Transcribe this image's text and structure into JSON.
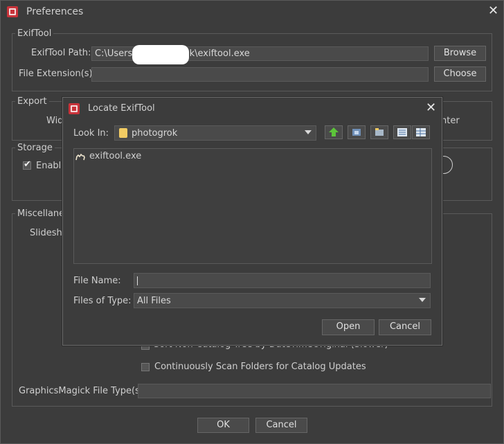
{
  "window": {
    "title": "Preferences",
    "exiftool_group": {
      "label": "ExifTool",
      "path_label": "ExifTool Path:",
      "path_prefix": "C:\\Users\\",
      "path_suffix": "k\\exiftool.exe",
      "browse": "Browse",
      "ext_label": "File Extension(s):",
      "choose": "Choose"
    },
    "export_group": {
      "label": "Export",
      "partial_left": "Wid",
      "partial_right": "nter"
    },
    "storage_group": {
      "label": "Storage",
      "enable_partial": "Enable"
    },
    "misc_group": {
      "label": "Miscellaneo",
      "slideshow_partial": "Slidesho",
      "obscured_option": "Sort Non-Catalog Tree by DateTimeOriginal (Slower)",
      "scan_option": "Continuously Scan Folders for Catalog Updates",
      "graphicsmagick_label": "GraphicsMagick File Type(s):"
    },
    "ok": "OK",
    "cancel": "Cancel"
  },
  "dialog": {
    "title": "Locate ExifTool",
    "look_in_label": "Look In:",
    "look_in_value": "photogrok",
    "files": [
      {
        "name": "exiftool.exe",
        "icon": "camel-icon"
      }
    ],
    "file_name_label": "File Name:",
    "file_name_value": "",
    "files_of_type_label": "Files of Type:",
    "files_of_type_value": "All Files",
    "open": "Open",
    "cancel": "Cancel",
    "toolbar_icons": [
      "up-folder-icon",
      "home-folder-icon",
      "new-folder-icon",
      "list-view-icon",
      "details-view-icon"
    ]
  },
  "colors": {
    "background": "#3c3c3c",
    "accent_red": "#c8333a",
    "folder": "#f2cc63",
    "up_arrow": "#5cc43a"
  }
}
